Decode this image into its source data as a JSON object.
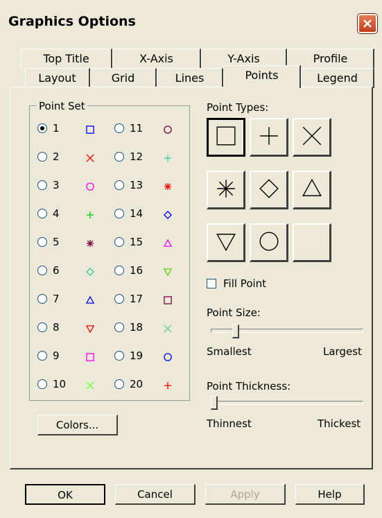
{
  "window": {
    "title": "Graphics Options"
  },
  "tabs_back": [
    "Top Title",
    "X-Axis",
    "Y-Axis",
    "Profile"
  ],
  "tabs_front": [
    "Layout",
    "Grid",
    "Lines",
    "Points",
    "Legend"
  ],
  "active_tab": "Points",
  "point_set": {
    "label": "Point Set",
    "selected": "1",
    "items": [
      {
        "n": "1",
        "marker": "square",
        "color": "#0000ff"
      },
      {
        "n": "2",
        "marker": "x",
        "color": "#ff0000"
      },
      {
        "n": "3",
        "marker": "circle",
        "color": "#ff00ff"
      },
      {
        "n": "4",
        "marker": "plus",
        "color": "#00cc00"
      },
      {
        "n": "5",
        "marker": "asterisk",
        "color": "#800040"
      },
      {
        "n": "6",
        "marker": "diamond",
        "color": "#33cc99"
      },
      {
        "n": "7",
        "marker": "triangle-up",
        "color": "#0000ff"
      },
      {
        "n": "8",
        "marker": "triangle-down",
        "color": "#ff0000"
      },
      {
        "n": "9",
        "marker": "square",
        "color": "#ff00ff"
      },
      {
        "n": "10",
        "marker": "x",
        "color": "#66ff33"
      },
      {
        "n": "11",
        "marker": "circle",
        "color": "#800040"
      },
      {
        "n": "12",
        "marker": "plus",
        "color": "#33cc99"
      },
      {
        "n": "13",
        "marker": "asterisk",
        "color": "#ff0000"
      },
      {
        "n": "14",
        "marker": "diamond",
        "color": "#0000ff"
      },
      {
        "n": "15",
        "marker": "triangle-up",
        "color": "#ff00ff"
      },
      {
        "n": "16",
        "marker": "triangle-down",
        "color": "#66cc00"
      },
      {
        "n": "17",
        "marker": "square",
        "color": "#800040"
      },
      {
        "n": "18",
        "marker": "x",
        "color": "#66cc99"
      },
      {
        "n": "19",
        "marker": "circle",
        "color": "#0000ff"
      },
      {
        "n": "20",
        "marker": "plus",
        "color": "#ff0000"
      }
    ]
  },
  "point_types": {
    "label": "Point Types:",
    "types": [
      "square",
      "plus",
      "x",
      "asterisk",
      "diamond",
      "triangle-up",
      "triangle-down",
      "circle",
      "none"
    ],
    "selected": "square"
  },
  "fill_point": {
    "label": "Fill Point",
    "checked": false
  },
  "point_size": {
    "label": "Point Size:",
    "min_label": "Smallest",
    "max_label": "Largest",
    "value": 0.15
  },
  "point_thickness": {
    "label": "Point Thickness:",
    "min_label": "Thinnest",
    "max_label": "Thickest",
    "value": 0.0
  },
  "buttons": {
    "colors": "Colors...",
    "ok": "OK",
    "cancel": "Cancel",
    "apply": "Apply",
    "help": "Help"
  }
}
